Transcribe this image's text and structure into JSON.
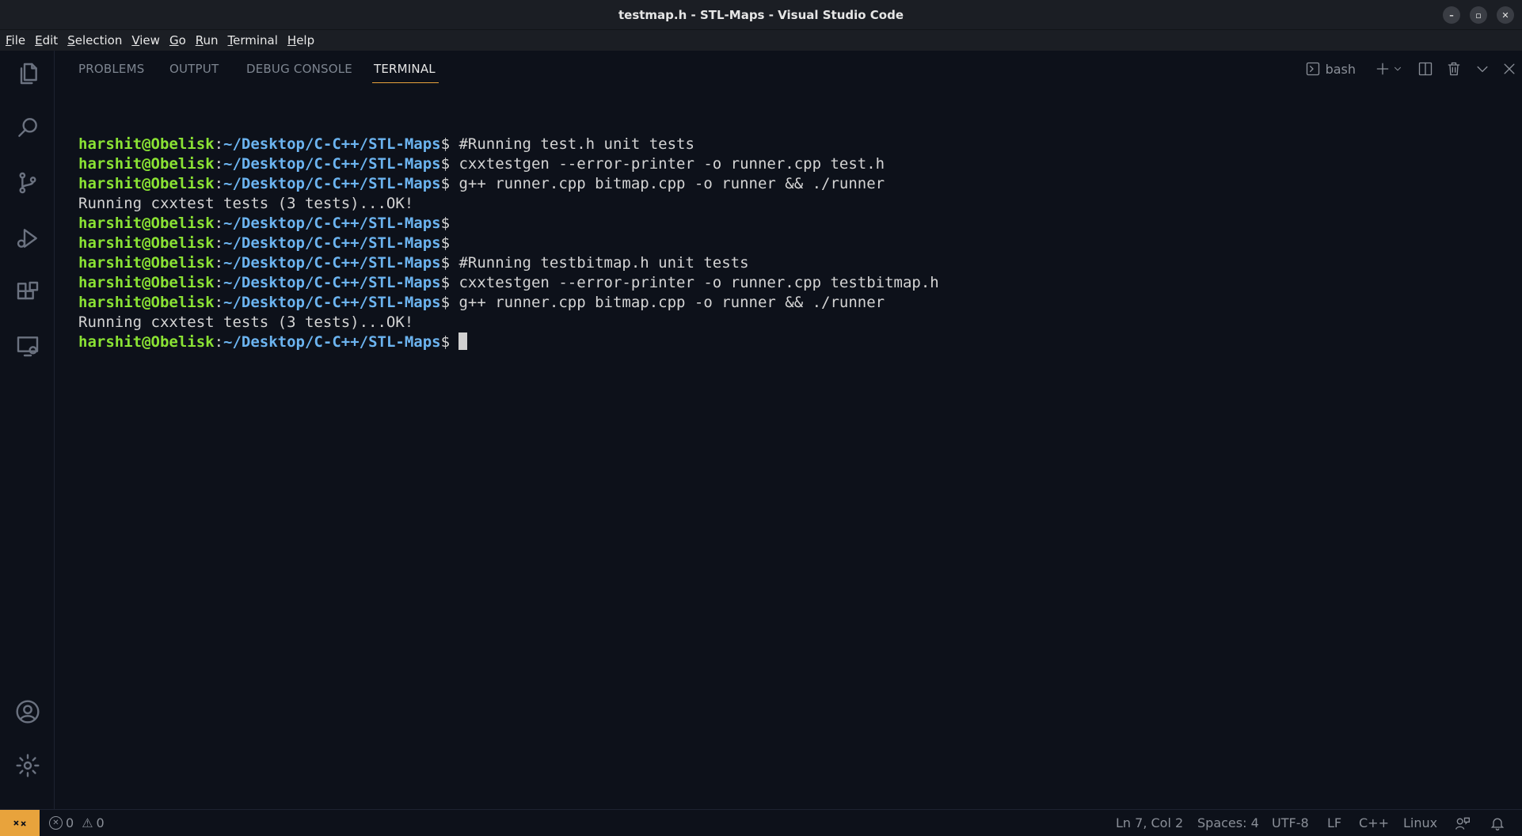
{
  "window": {
    "title": "testmap.h - STL-Maps - Visual Studio Code",
    "minimize": "–",
    "restore": "▫",
    "close": "✕"
  },
  "menu": [
    {
      "key": "F",
      "rest": "ile"
    },
    {
      "key": "E",
      "rest": "dit"
    },
    {
      "key": "S",
      "rest": "election"
    },
    {
      "key": "V",
      "rest": "iew"
    },
    {
      "key": "G",
      "rest": "o"
    },
    {
      "key": "R",
      "rest": "un"
    },
    {
      "key": "T",
      "rest": "erminal"
    },
    {
      "key": "H",
      "rest": "elp"
    }
  ],
  "panel": {
    "tabs": [
      "PROBLEMS",
      "OUTPUT",
      "DEBUG CONSOLE",
      "TERMINAL"
    ],
    "active_tab": "TERMINAL",
    "shell_name": "bash"
  },
  "terminal": {
    "user": "harshit@Obelisk",
    "path": "~/Desktop/C-C++/STL-Maps",
    "lines": [
      {
        "type": "prompt",
        "cmd": "#Running test.h unit tests"
      },
      {
        "type": "prompt",
        "cmd": "cxxtestgen --error-printer -o runner.cpp test.h"
      },
      {
        "type": "prompt",
        "cmd": "g++ runner.cpp bitmap.cpp -o runner && ./runner"
      },
      {
        "type": "output",
        "text": "Running cxxtest tests (3 tests)...OK!"
      },
      {
        "type": "prompt",
        "cmd": ""
      },
      {
        "type": "prompt",
        "cmd": ""
      },
      {
        "type": "prompt",
        "cmd": "#Running testbitmap.h unit tests"
      },
      {
        "type": "prompt",
        "cmd": "cxxtestgen --error-printer -o runner.cpp testbitmap.h"
      },
      {
        "type": "prompt",
        "cmd": "g++ runner.cpp bitmap.cpp -o runner && ./runner"
      },
      {
        "type": "output",
        "text": "Running cxxtest tests (3 tests)...OK!"
      },
      {
        "type": "prompt",
        "cmd": "",
        "cursor": true
      }
    ]
  },
  "status": {
    "errors": "0",
    "warnings": "0",
    "position": "Ln 7, Col 2",
    "spaces": "Spaces: 4",
    "encoding": "UTF-8",
    "eol": "LF",
    "language": "C++",
    "platform": "Linux"
  },
  "colors": {
    "accent": "#e8a33c",
    "user": "#8ae234",
    "path": "#6cb4f0",
    "background": "#0d111a"
  }
}
